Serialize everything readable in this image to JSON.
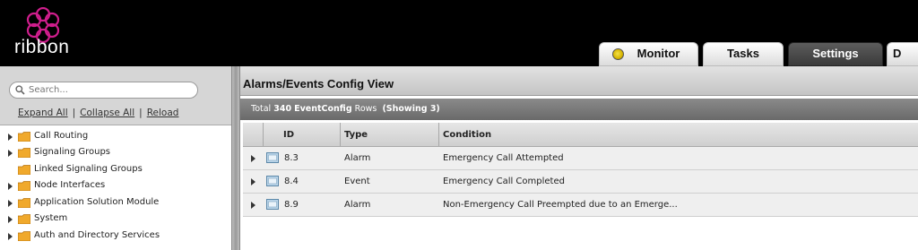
{
  "brand": {
    "logo_text": "ribbon",
    "accent_color": "#d01e8d"
  },
  "tabs": [
    {
      "label": "Monitor",
      "icon": "status-dot-icon",
      "status_color": "#e8cf1e"
    },
    {
      "label": "Tasks"
    },
    {
      "label": "Settings",
      "active": true
    },
    {
      "label": "D"
    }
  ],
  "sidebar": {
    "search_placeholder": "Search...",
    "links": {
      "expand_all": "Expand All",
      "collapse_all": "Collapse All",
      "reload": "Reload",
      "separator": "|"
    },
    "tree": [
      {
        "label": "Call Routing",
        "expandable": true
      },
      {
        "label": "Signaling Groups",
        "expandable": true
      },
      {
        "label": "Linked Signaling Groups",
        "expandable": false
      },
      {
        "label": "Node Interfaces",
        "expandable": true
      },
      {
        "label": "Application Solution Module",
        "expandable": true
      },
      {
        "label": "System",
        "expandable": true
      },
      {
        "label": "Auth and Directory Services",
        "expandable": true
      }
    ]
  },
  "main": {
    "title": "Alarms/Events Config View",
    "totals": {
      "prefix": "Total",
      "count": "340",
      "entity": "EventConfig",
      "rows_word": "Rows",
      "showing": "(Showing 3)"
    },
    "columns": [
      "ID",
      "Type",
      "Condition"
    ],
    "rows": [
      {
        "id": "8.3",
        "type": "Alarm",
        "condition": "Emergency Call Attempted"
      },
      {
        "id": "8.4",
        "type": "Event",
        "condition": "Emergency Call Completed"
      },
      {
        "id": "8.9",
        "type": "Alarm",
        "condition": "Non-Emergency Call Preempted due to an Emerge..."
      }
    ]
  }
}
